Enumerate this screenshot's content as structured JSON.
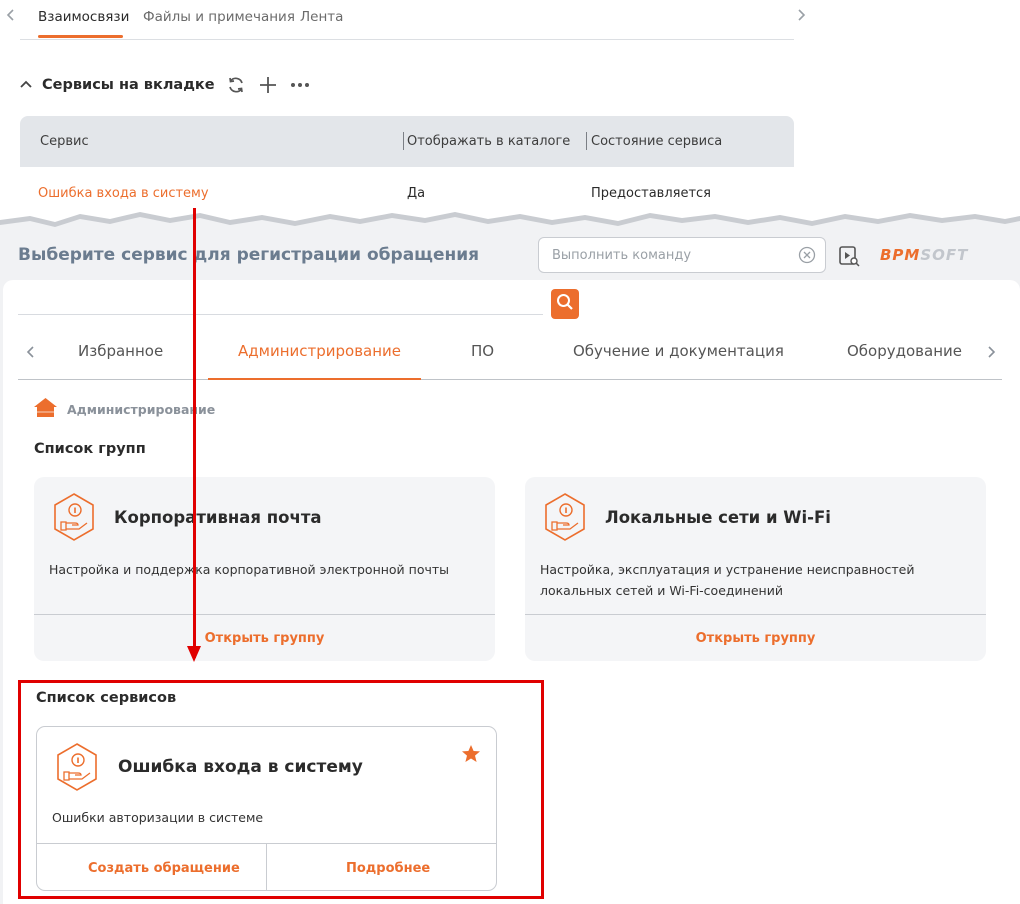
{
  "top_tabs": [
    {
      "label": "Взаимосвязи",
      "active": true
    },
    {
      "label": "Файлы и примечания",
      "active": false
    },
    {
      "label": "Лента",
      "active": false
    }
  ],
  "services_section": {
    "title": "Сервисы на вкладке",
    "columns": [
      "Сервис",
      "Отображать в каталоге",
      "Состояние сервиса"
    ],
    "rows": [
      {
        "service": "Ошибка входа в систему",
        "show_in_catalog": "Да",
        "status": "Предоставляется"
      }
    ]
  },
  "portal": {
    "title": "Выберите сервис для регистрации обращения",
    "command_placeholder": "Выполнить команду",
    "logo_text_a": "BPM",
    "logo_text_b": "SOFT",
    "categories": [
      {
        "label": "Избранное",
        "active": false
      },
      {
        "label": "Администрирование",
        "active": true
      },
      {
        "label": "ПО",
        "active": false
      },
      {
        "label": "Обучение и документация",
        "active": false
      },
      {
        "label": "Оборудование",
        "active": false
      }
    ],
    "breadcrumb": "Администрирование",
    "groups_heading": "Список групп",
    "groups": [
      {
        "title": "Корпоративная почта",
        "description": "Настройка и поддержка корпоративной электронной почты",
        "action": "Открыть группу"
      },
      {
        "title": "Локальные сети и Wi-Fi",
        "description": "Настройка, эксплуатация и устранение неисправностей локальных сетей и Wi-Fi-соединений",
        "action": "Открыть группу"
      }
    ],
    "services_heading": "Список сервисов",
    "service_card": {
      "title": "Ошибка входа в систему",
      "description": "Ошибки авторизации в системе",
      "favorite": true,
      "primary_action": "Создать обращение",
      "secondary_action": "Подробнее"
    }
  },
  "colors": {
    "accent": "#ec6e2d",
    "highlight": "#e00000",
    "portal_title": "#6b7c8f"
  },
  "icons": [
    "chevron-left-icon",
    "chevron-right-icon",
    "chevron-up-icon",
    "refresh-icon",
    "plus-icon",
    "more-icon",
    "clear-icon",
    "video-search-icon",
    "search-icon",
    "home-icon",
    "service-info-icon",
    "star-icon"
  ]
}
